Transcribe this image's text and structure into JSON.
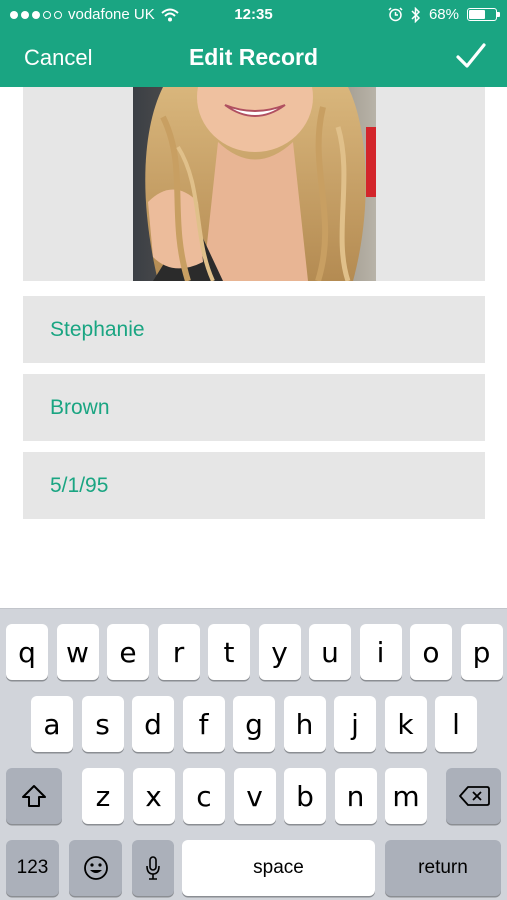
{
  "status_bar": {
    "carrier": "vodafone UK",
    "time": "12:35",
    "battery": "68%",
    "battery_level": 0.68,
    "icons": [
      "signal-dots",
      "wifi-icon",
      "alarm-icon",
      "bluetooth-icon",
      "battery-icon"
    ]
  },
  "nav": {
    "cancel_label": "Cancel",
    "title": "Edit Record",
    "confirm_icon": "checkmark-icon"
  },
  "form": {
    "first_name": "Stephanie",
    "last_name": "Brown",
    "date_of_birth": "5/1/95"
  },
  "keyboard": {
    "row1": [
      "q",
      "w",
      "e",
      "r",
      "t",
      "y",
      "u",
      "i",
      "o",
      "p"
    ],
    "row2": [
      "a",
      "s",
      "d",
      "f",
      "g",
      "h",
      "j",
      "k",
      "l"
    ],
    "row3": [
      "z",
      "x",
      "c",
      "v",
      "b",
      "n",
      "m"
    ],
    "numbers_label": "123",
    "space_label": "space",
    "return_label": "return",
    "icons": [
      "shift-icon",
      "delete-icon",
      "emoji-icon",
      "microphone-icon"
    ]
  },
  "colors": {
    "accent": "#1aa582",
    "field_bg": "#e6e6e6",
    "keyboard_bg": "#d1d4da",
    "key_dark": "#abb0ba"
  }
}
